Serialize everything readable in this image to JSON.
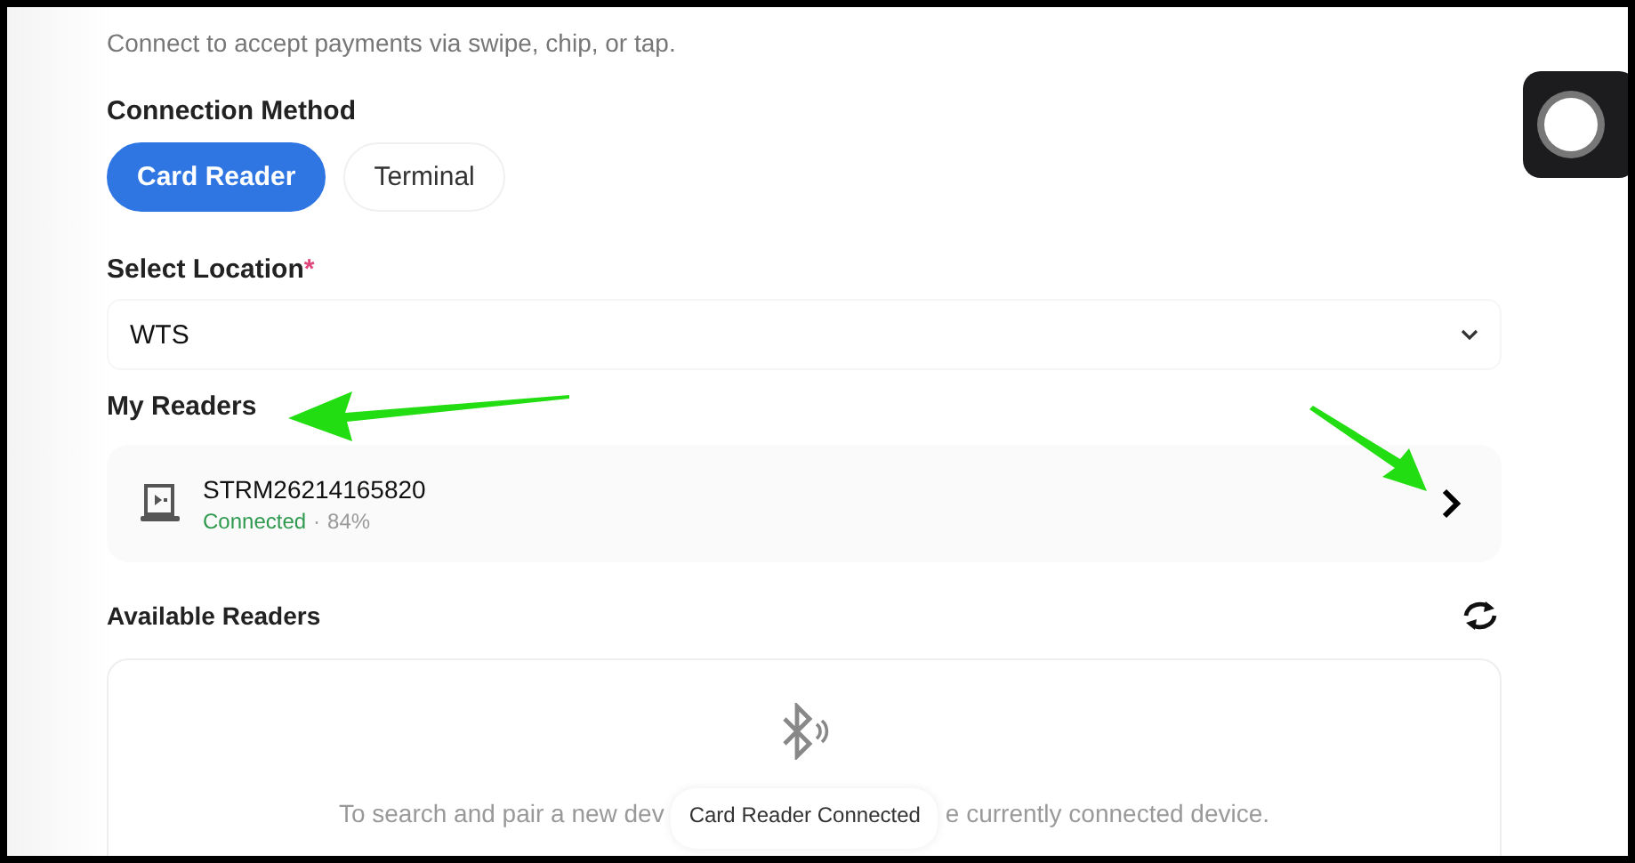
{
  "subtitle": "Connect to accept payments via swipe, chip, or tap.",
  "connection_method": {
    "label": "Connection Method",
    "options": [
      {
        "label": "Card Reader",
        "selected": true
      },
      {
        "label": "Terminal",
        "selected": false
      }
    ]
  },
  "location": {
    "label": "Select Location",
    "required_mark": "*",
    "value": "WTS"
  },
  "my_readers": {
    "title": "My Readers",
    "readers": [
      {
        "name": "STRM26214165820",
        "status": "Connected",
        "separator": "·",
        "battery": "84%"
      }
    ]
  },
  "available_readers": {
    "title": "Available Readers",
    "message_start": "To search and pair a new dev",
    "message_end": "e currently connected device."
  },
  "toast": "Card Reader Connected"
}
